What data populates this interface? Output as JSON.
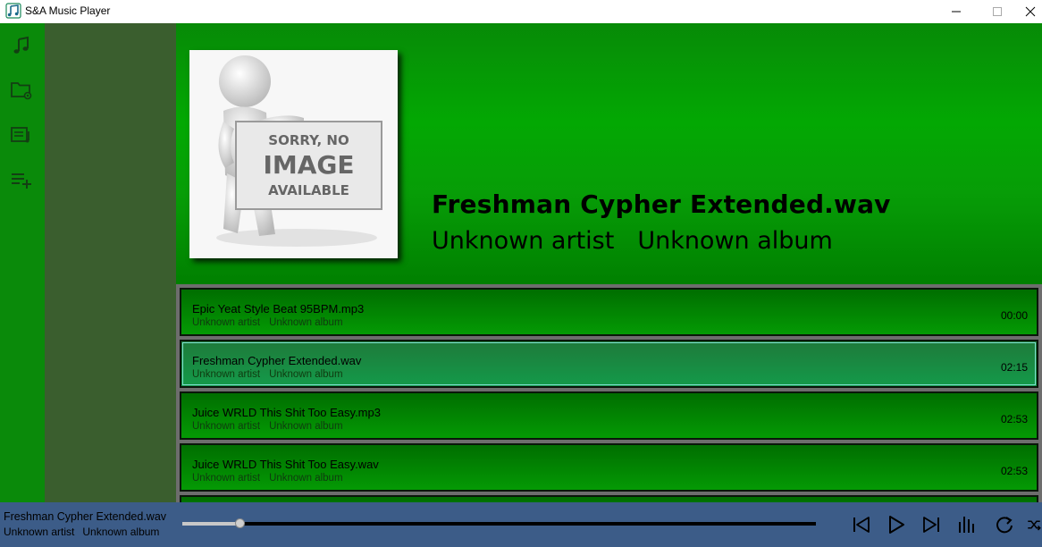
{
  "window": {
    "title": "S&A Music Player"
  },
  "rail": {
    "items": [
      {
        "icon": "music-note-icon"
      },
      {
        "icon": "folder-settings-icon"
      },
      {
        "icon": "music-library-icon"
      },
      {
        "icon": "add-to-playlist-icon"
      }
    ]
  },
  "cover": {
    "lines": [
      "SORRY, NO",
      "IMAGE",
      "AVAILABLE"
    ]
  },
  "now_playing": {
    "title": "Freshman Cypher Extended.wav",
    "artist": "Unknown artist",
    "album": "Unknown album"
  },
  "tracks": [
    {
      "name": "Epic Yeat Style Beat 95BPM.mp3",
      "artist": "Unknown artist",
      "album": "Unknown album",
      "duration": "00:00",
      "selected": false
    },
    {
      "name": "Freshman Cypher Extended.wav",
      "artist": "Unknown artist",
      "album": "Unknown album",
      "duration": "02:15",
      "selected": true
    },
    {
      "name": "Juice WRLD This Shit Too Easy.mp3",
      "artist": "Unknown artist",
      "album": "Unknown album",
      "duration": "02:53",
      "selected": false
    },
    {
      "name": "Juice WRLD This Shit Too Easy.wav",
      "artist": "Unknown artist",
      "album": "Unknown album",
      "duration": "02:53",
      "selected": false
    }
  ],
  "player": {
    "title": "Freshman Cypher Extended.wav",
    "artist": "Unknown artist",
    "album": "Unknown album",
    "progress": 0.09
  },
  "colors": {
    "rail": "#0a8a0a",
    "side_panel": "#3a5e2e",
    "header_green": "#03a803",
    "player_bar": "#3c5c88",
    "track_list_bg": "#6d6d6d"
  }
}
